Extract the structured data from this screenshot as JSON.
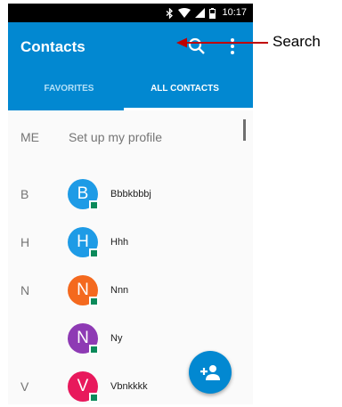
{
  "status_bar": {
    "time": "10:17",
    "icons": [
      "bluetooth-icon",
      "wifi-icon",
      "cell-signal-icon",
      "battery-icon"
    ]
  },
  "app_bar": {
    "title": "Contacts",
    "actions": [
      "search-icon",
      "more-vert-icon"
    ]
  },
  "tabs": [
    {
      "label": "FAVORITES",
      "selected": false
    },
    {
      "label": "ALL CONTACTS",
      "selected": true
    }
  ],
  "profile": {
    "label": "ME",
    "text": "Set up my profile"
  },
  "contacts": [
    {
      "section": "B",
      "initial": "B",
      "name": "Bbbkbbbj",
      "color": "#1e9be6"
    },
    {
      "section": "H",
      "initial": "H",
      "name": "Hhh",
      "color": "#1e9be6"
    },
    {
      "section": "N",
      "initial": "N",
      "name": "Nnn",
      "color": "#f4691e"
    },
    {
      "section": "",
      "initial": "N",
      "name": "Ny",
      "color": "#8e3ab4"
    },
    {
      "section": "V",
      "initial": "V",
      "name": "Vbnkkkk",
      "color": "#e8195c"
    }
  ],
  "fab": {
    "icon": "add-person-icon"
  },
  "annotation": {
    "label": "Search",
    "arrow_color": "#c00000"
  },
  "colors": {
    "primary": "#0288d1",
    "badge": "#0b8a5a"
  }
}
